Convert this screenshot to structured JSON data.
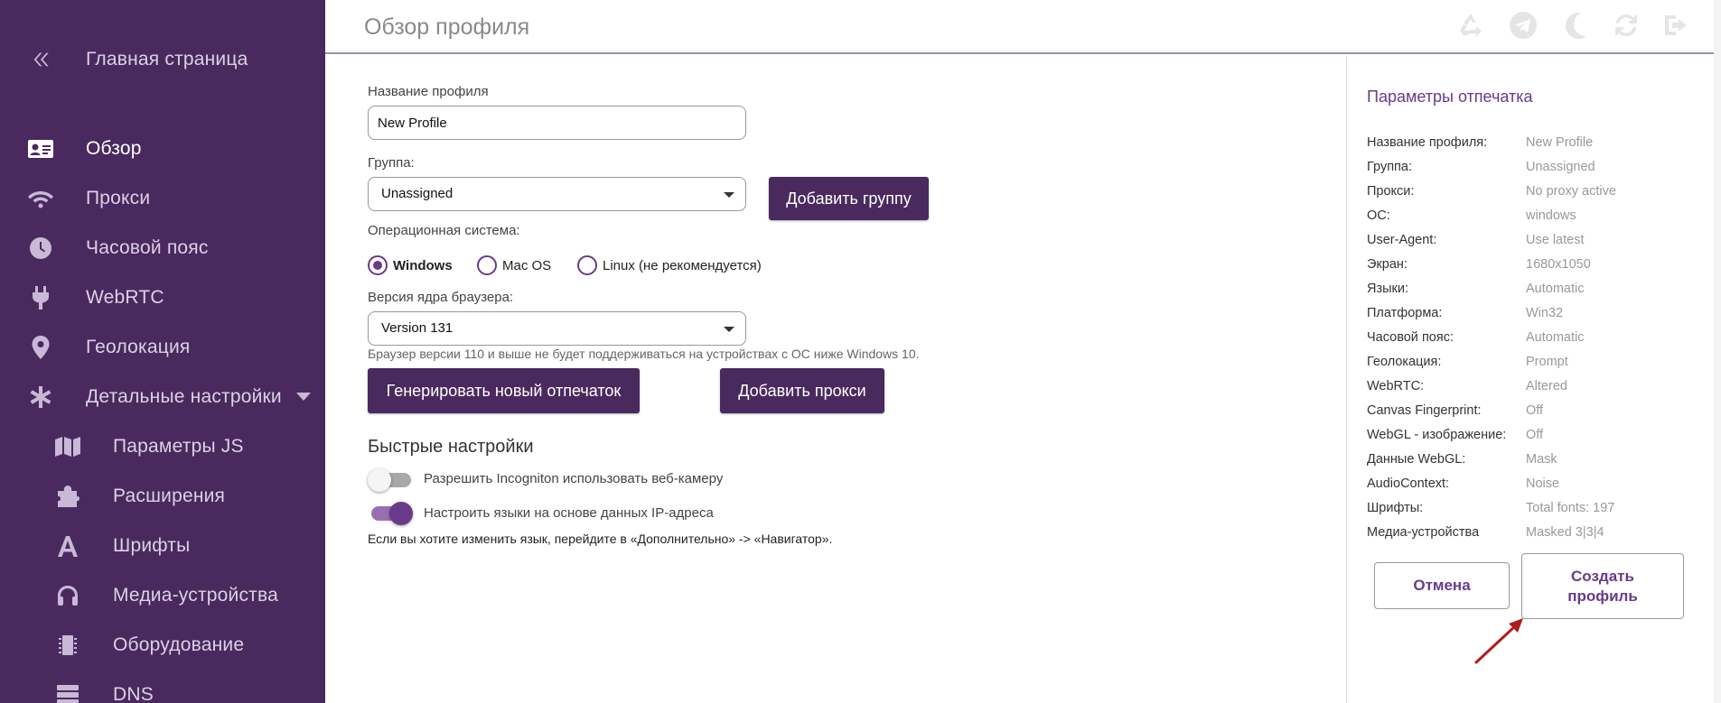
{
  "sidebar": {
    "home_label": "Главная страница",
    "items": [
      {
        "label": "Обзор"
      },
      {
        "label": "Прокси"
      },
      {
        "label": "Часовой пояс"
      },
      {
        "label": "WebRTC"
      },
      {
        "label": "Геолокация"
      },
      {
        "label": "Детальные настройки"
      }
    ],
    "sub_items": [
      {
        "label": "Параметры JS"
      },
      {
        "label": "Расширения"
      },
      {
        "label": "Шрифты"
      },
      {
        "label": "Медиа-устройства"
      },
      {
        "label": "Оборудование"
      },
      {
        "label": "DNS"
      }
    ]
  },
  "header": {
    "title": "Обзор профиля"
  },
  "form": {
    "profile_name_label": "Название профиля",
    "profile_name_value": "New Profile",
    "group_label": "Группа:",
    "group_value": "Unassigned",
    "add_group_button": "Добавить группу",
    "os_label": "Операционная система:",
    "os_options": [
      {
        "label": "Windows",
        "selected": true
      },
      {
        "label": "Mac OS",
        "selected": false
      },
      {
        "label": "Linux (не рекомендуется)",
        "selected": false
      }
    ],
    "browser_version_label": "Версия ядра браузера:",
    "browser_version_value": "Version 131",
    "browser_version_hint": "Браузер версии 110 и выше не будет поддерживаться на устройствах с ОС ниже Windows 10.",
    "generate_button": "Генерировать новый отпечаток",
    "add_proxy_button": "Добавить прокси"
  },
  "quick_settings": {
    "title": "Быстрые настройки",
    "toggles": [
      {
        "label": "Разрешить Incogniton использовать веб-камеру",
        "on": false
      },
      {
        "label": "Настроить языки на основе данных IP-адреса",
        "on": true
      }
    ],
    "note": "Если вы хотите изменить язык, перейдите в «Дополнительно» -> «Навигатор»."
  },
  "fingerprint": {
    "title": "Параметры отпечатка",
    "rows": [
      {
        "key": "Название профиля:",
        "value": "New Profile"
      },
      {
        "key": "Группа:",
        "value": "Unassigned"
      },
      {
        "key": "Прокси:",
        "value": "No proxy active"
      },
      {
        "key": "ОС:",
        "value": "windows"
      },
      {
        "key": "User-Agent:",
        "value": "Use latest"
      },
      {
        "key": "Экран:",
        "value": "1680x1050"
      },
      {
        "key": "Языки:",
        "value": "Automatic"
      },
      {
        "key": "Платформа:",
        "value": "Win32"
      },
      {
        "key": "Часовой пояс:",
        "value": "Automatic"
      },
      {
        "key": "Геолокация:",
        "value": "Prompt"
      },
      {
        "key": "WebRTC:",
        "value": "Altered"
      },
      {
        "key": "Canvas Fingerprint:",
        "value": "Off"
      },
      {
        "key": "WebGL - изображение:",
        "value": "Off"
      },
      {
        "key": "Данные WebGL:",
        "value": "Mask"
      },
      {
        "key": "AudioContext:",
        "value": "Noise"
      },
      {
        "key": "Шрифты:",
        "value": "Total fonts: 197"
      },
      {
        "key": "Медиа-устройства",
        "value": "Masked 3|3|4"
      }
    ],
    "cancel_button": "Отмена",
    "create_button": "Создать профиль"
  },
  "colors": {
    "sidebar_bg": "#4a2a5e",
    "accent": "#6a3a8a",
    "arrow": "#b01c1c"
  }
}
